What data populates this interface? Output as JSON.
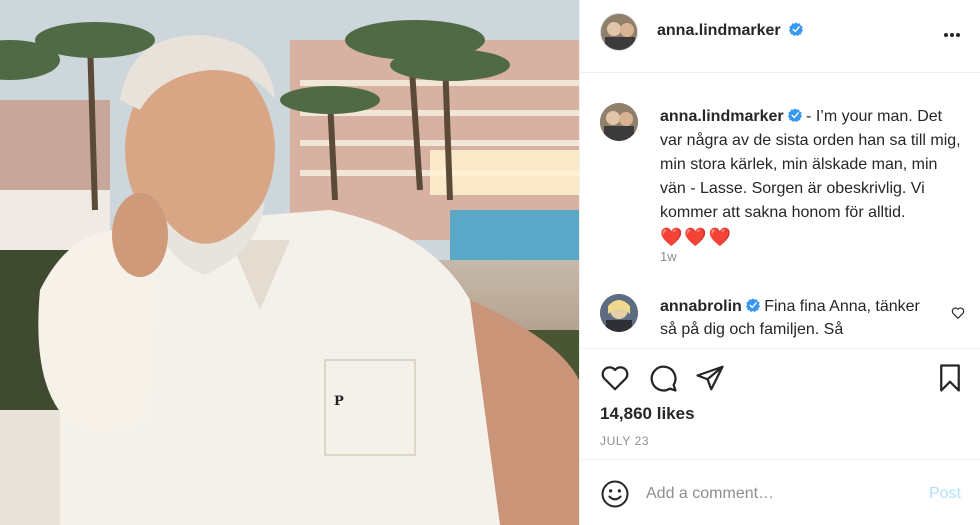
{
  "post": {
    "owner": "anna.lindmarker",
    "more_icon": "more-horizontal-icon",
    "caption": {
      "username": "anna.lindmarker",
      "text": " - I’m your man. Det var några av de sista orden han sa till mig, min stora kärlek, min älskade man, min vän - Lasse. Sorgen är obeskrivlig. Vi kommer att sakna honom för alltid.",
      "hearts": "❤️❤️❤️",
      "time": "1w"
    },
    "reply": {
      "username": "annabrolin",
      "text": " Fina fina Anna, tänker så på dig och familjen. Så"
    },
    "likes": "14,860 likes",
    "date": "JULY 23",
    "add_comment": {
      "placeholder": "Add a comment…",
      "post_label": "Post"
    },
    "colors": {
      "verified": "#3897f0",
      "post_button_disabled": "#b2dffc",
      "secondary_text": "#8e8e8e",
      "divider": "#efefef"
    }
  }
}
